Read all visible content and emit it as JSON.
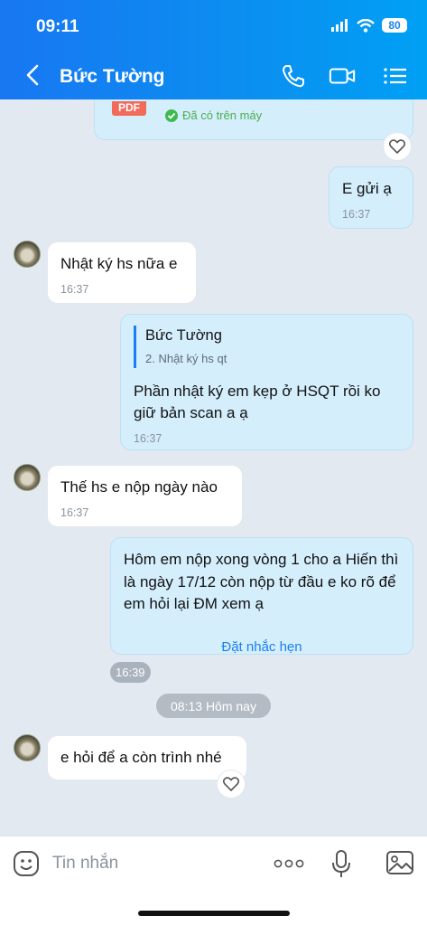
{
  "status_bar": {
    "time": "09:11",
    "battery": "80"
  },
  "header": {
    "title": "Bức Tường"
  },
  "top_file": {
    "pdf_label": "PDF",
    "status": "Đã có trên máy"
  },
  "messages": [
    {
      "side": "out",
      "text": "E gửi ạ",
      "time": "16:37"
    },
    {
      "side": "in",
      "text": "Nhật ký hs nữa e",
      "time": "16:37"
    },
    {
      "side": "out",
      "quote_name": "Bức Tường",
      "quote_text": "2. Nhật ký hs qt",
      "text": "Phần nhật ký em kẹp ở HSQT rồi ko giữ bản scan a ạ",
      "time": "16:37"
    },
    {
      "side": "in",
      "text": "Thế hs e nộp ngày nào",
      "time": "16:37"
    },
    {
      "side": "out",
      "text": "Hôm em nộp xong vòng 1 cho a Hiến thì là ngày 17/12 còn nộp từ đầu e ko rõ để em hỏi lại ĐM xem ạ",
      "action": "Đặt nhắc hẹn",
      "time": "16:39"
    },
    {
      "side": "in",
      "text": "e hỏi để a còn trình nhé"
    }
  ],
  "date_separator": "08:13 Hôm nay",
  "composer": {
    "placeholder": "Tin nhắn"
  }
}
